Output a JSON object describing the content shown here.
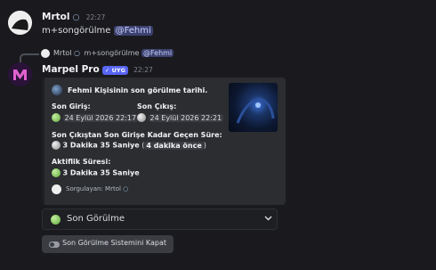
{
  "message1": {
    "username": "Mrtol",
    "time": "22:27",
    "text": "m+songörülme",
    "mention": "@Fehmi"
  },
  "reply_ref": {
    "username": "Mrtol",
    "text": "m+songörülme",
    "mention": "@Fehmi"
  },
  "message2": {
    "username": "Marpel Pro",
    "badge": "UYG",
    "time": "22:27"
  },
  "embed": {
    "title": "Fehmi Kişisinin son görülme tarihi.",
    "last_login_label": "Son Giriş:",
    "last_login_value": "24 Eylül 2026 22:17",
    "last_logout_label": "Son Çıkış:",
    "last_logout_value": "24 Eylül 2026 22:21",
    "gap_label": "Son Çıkıştan Son Girişe Kadar Geçen Süre:",
    "gap_value": "3 Dakika 35 Saniye",
    "gap_ago": "4 dakika önce",
    "activity_label": "Aktiflik Süresi:",
    "activity_value": "3 Dakika 35 Saniye",
    "footer": "Sorgulayan: Mrtol"
  },
  "select": {
    "selected": "Son Görülme"
  },
  "button": {
    "label": "Son Görülme Sistemini Kapat"
  },
  "colors": {
    "background": "#1a1a1e",
    "embed_bg": "#2b2d31",
    "mention_bg": "#3c4270",
    "badge_bg": "#5865f2"
  }
}
